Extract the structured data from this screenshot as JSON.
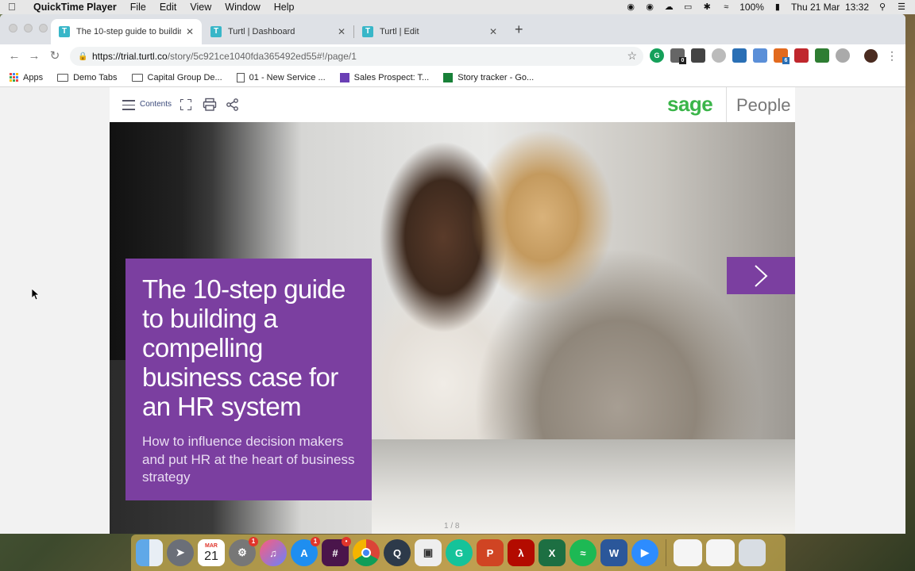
{
  "menubar": {
    "app_name": "QuickTime Player",
    "menus": [
      "File",
      "Edit",
      "View",
      "Window",
      "Help"
    ],
    "battery": "100%",
    "datetime": "Thu 21 Mar  13:32"
  },
  "browser": {
    "tabs": [
      {
        "title": "The 10-step guide to building a",
        "favicon": "T",
        "active": true
      },
      {
        "title": "Turtl | Dashboard",
        "favicon": "T",
        "active": false
      },
      {
        "title": "Turtl | Edit",
        "favicon": "T",
        "active": false
      }
    ],
    "url_host": "https://trial.turtl.co",
    "url_path": "/story/5c921ce1040fda365492ed55#!/page/1",
    "bookmarks": [
      {
        "label": "Apps",
        "icon": "apps-grid-icon"
      },
      {
        "label": "Demo Tabs",
        "icon": "folder-icon"
      },
      {
        "label": "Capital Group De...",
        "icon": "folder-icon"
      },
      {
        "label": "01 - New Service ...",
        "icon": "document-icon"
      },
      {
        "label": "Sales Prospect: T...",
        "icon": "purple-form-icon"
      },
      {
        "label": "Story tracker - Go...",
        "icon": "sheets-icon"
      }
    ],
    "extension_badges": {
      "ext2": "0",
      "ext8": "6"
    }
  },
  "story": {
    "contents_label": "Contents",
    "brand_primary": "sage",
    "brand_secondary": "People",
    "title": "The 10-step guide to building a compelling business case for an HR system",
    "subtitle": "How to influence decision makers and put HR at the heart of business strategy",
    "page_indicator": "1 / 8",
    "accent_color": "#7b3fa0",
    "brand_color": "#3bb54a"
  },
  "dock": {
    "calendar_month": "MAR",
    "calendar_day": "21",
    "badges": {
      "system_preferences": "1",
      "app_store": "1",
      "slack": "•"
    }
  }
}
